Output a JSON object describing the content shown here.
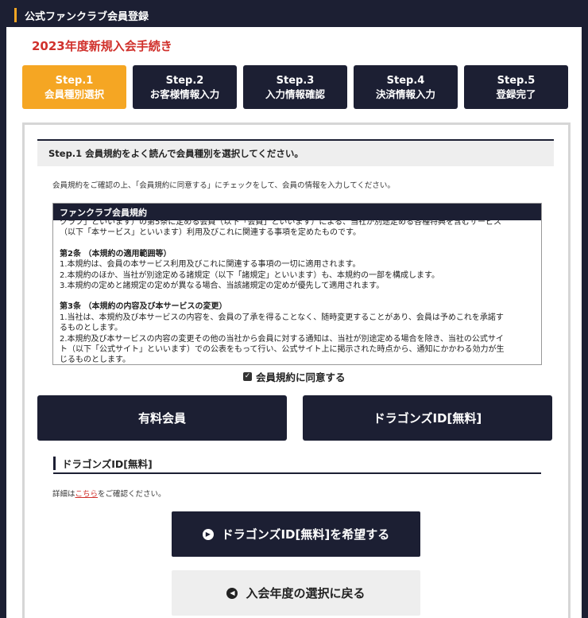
{
  "titlebar": {
    "title": "公式ファンクラブ会員登録"
  },
  "heading": "2023年度新規入会手続き",
  "steps": [
    {
      "num": "Step.1",
      "name": "会員種別選択",
      "active": true
    },
    {
      "num": "Step.2",
      "name": "お客様情報入力",
      "active": false
    },
    {
      "num": "Step.3",
      "name": "入力情報確認",
      "active": false
    },
    {
      "num": "Step.4",
      "name": "決済情報入力",
      "active": false
    },
    {
      "num": "Step.5",
      "name": "登録完了",
      "active": false
    }
  ],
  "section": {
    "heading": "Step.1 会員規約をよく読んで会員種別を選択してください。",
    "intro": "会員規約をご確認の上、「会員規約に同意する」にチェックをして、会員の情報を入力してください。"
  },
  "terms": {
    "title": "ファンクラブ会員規約",
    "lines": [
      {
        "text": "クラブ」といいます）の第5条に定める会員（以下「会員」といいます）による、当社が別途定める各種特典を含むサービス",
        "bold": false
      },
      {
        "text": "（以下「本サービス」といいます）利用及びこれに関連する事項を定めたものです。",
        "bold": false
      },
      {
        "text": "",
        "bold": false
      },
      {
        "text": "第2条 （本規約の適用範囲等）",
        "bold": true
      },
      {
        "text": "1.本規約は、会員の本サービス利用及びこれに関連する事項の一切に適用されます。",
        "bold": false
      },
      {
        "text": "2.本規約のほか、当社が別途定める諸規定（以下「諸規定」といいます）も、本規約の一部を構成します。",
        "bold": false
      },
      {
        "text": "3.本規約の定めと諸規定の定めが異なる場合、当該諸規定の定めが優先して適用されます。",
        "bold": false
      },
      {
        "text": "",
        "bold": false
      },
      {
        "text": "第3条 （本規約の内容及び本サービスの変更）",
        "bold": true
      },
      {
        "text": "1.当社は、本規約及び本サービスの内容を、会員の了承を得ることなく、随時変更することがあり、会員は予めこれを承諾す",
        "bold": false
      },
      {
        "text": "るものとします。",
        "bold": false
      },
      {
        "text": "2.本規約及び本サービスの内容の変更その他の当社から会員に対する通知は、当社が別途定める場合を除き、当社の公式サイ",
        "bold": false
      },
      {
        "text": "ト（以下「公式サイト」といいます）での公表をもって行い、公式サイト上に掲示された時点から、通知にかかわる効力が生",
        "bold": false
      },
      {
        "text": "じるものとします。",
        "bold": false
      }
    ]
  },
  "agree": {
    "label": "会員規約に同意する",
    "checked": true
  },
  "types": {
    "paid": "有料会員",
    "free": "ドラゴンズID[無料]"
  },
  "subsection": {
    "heading": "ドラゴンズID[無料]",
    "detail_prefix": "詳細は",
    "detail_link": "こちら",
    "detail_suffix": "をご確認ください。"
  },
  "cta": {
    "label": "ドラゴンズID[無料]を希望する"
  },
  "back": {
    "label": "入会年度の選択に戻る"
  },
  "colors": {
    "navy": "#1c1f33",
    "accent": "#f5a623",
    "red": "#d0302b"
  }
}
